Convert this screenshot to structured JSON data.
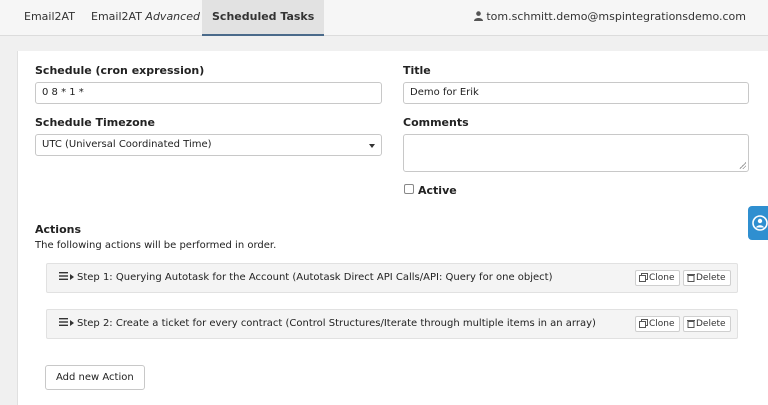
{
  "tabs": [
    {
      "label": "Email2AT",
      "active": false
    },
    {
      "label": "Email2AT",
      "suffix": "Advanced",
      "active": false
    },
    {
      "label": "Scheduled Tasks",
      "active": true
    }
  ],
  "user": {
    "email": "tom.schmitt.demo@mspintegrationsdemo.com",
    "icon": "user-icon"
  },
  "form": {
    "schedule_label": "Schedule (cron expression)",
    "schedule_value": "0 8 * 1 *",
    "title_label": "Title",
    "title_value": "Demo for Erik",
    "timezone_label": "Schedule Timezone",
    "timezone_value": "UTC (Universal Coordinated Time)",
    "comments_label": "Comments",
    "comments_value": "",
    "active_label": "Active",
    "active_checked": false
  },
  "actions": {
    "heading": "Actions",
    "description": "The following actions will be performed in order.",
    "steps": [
      {
        "label": "Step 1: Querying Autotask for the Account (Autotask Direct API Calls/API: Query for one object)",
        "clone_label": "Clone",
        "delete_label": "Delete"
      },
      {
        "label": "Step 2: Create a ticket for every contract (Control Structures/Iterate through multiple items in an array)",
        "clone_label": "Clone",
        "delete_label": "Delete"
      }
    ],
    "add_label": "Add new Action"
  },
  "colors": {
    "accent": "#4a6a8a",
    "help_widget": "#2f8fd0"
  }
}
